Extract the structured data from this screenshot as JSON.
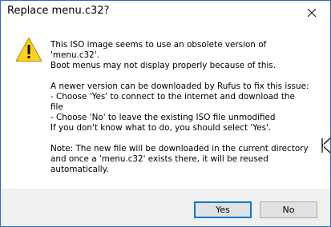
{
  "window": {
    "title": "Replace menu.c32?"
  },
  "message": {
    "lines": [
      "This ISO image seems to use an obsolete version of",
      "'menu.c32'.",
      "Boot menus may not display properly because of this.",
      "",
      "A newer version can be downloaded by Rufus to fix this issue:",
      "- Choose 'Yes' to connect to the internet and download the",
      "file",
      "- Choose 'No' to leave the existing ISO file unmodified",
      "If you don't know what to do, you should select 'Yes'.",
      "",
      "Note: The new file will be downloaded in the current directory",
      "and once a 'menu.c32' exists there, it will be reused",
      "automatically."
    ]
  },
  "buttons": {
    "yes": "Yes",
    "no": "No"
  },
  "icons": {
    "warning": "warning-icon",
    "close": "close-icon",
    "cursor": "resize-cursor-icon"
  },
  "colors": {
    "window_border": "#2b6cc4",
    "warning_fill": "#ffd21f",
    "default_button_border": "#0078d7",
    "footer_bg": "#f0f0f0"
  }
}
